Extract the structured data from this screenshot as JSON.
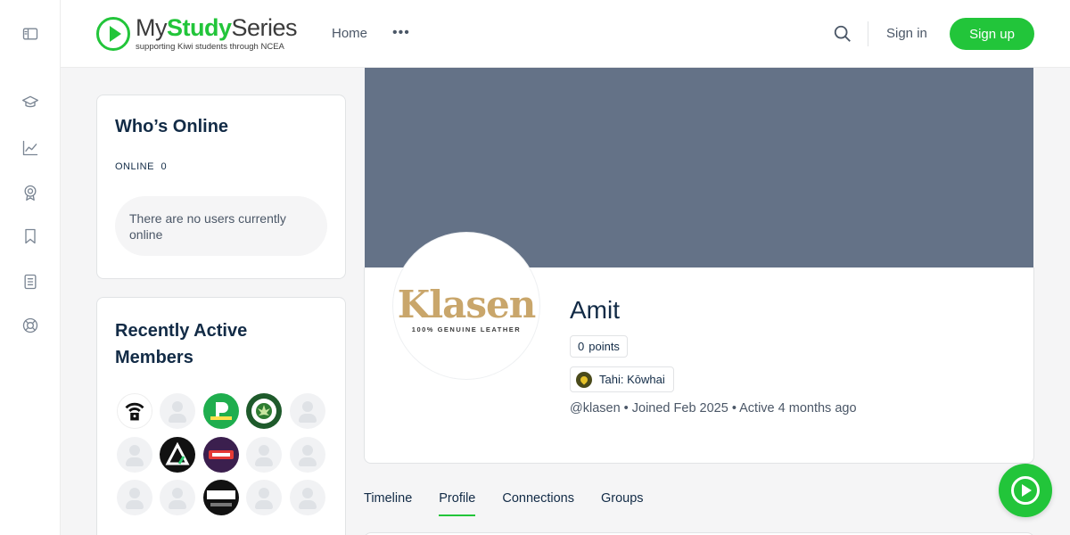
{
  "brand": {
    "name_prefix": "My",
    "name_highlight": "Study",
    "name_suffix": "Series",
    "tagline": "supporting Kiwi students through NCEA",
    "accent": "#22c53a"
  },
  "header": {
    "nav_home": "Home",
    "nav_more": "•••",
    "signin": "Sign in",
    "signup": "Sign up",
    "search_icon": "search-icon"
  },
  "rail": {
    "icons": [
      "sidebar-toggle-icon",
      "graduation-cap-icon",
      "chart-line-icon",
      "award-icon",
      "bookmark-icon",
      "document-list-icon",
      "help-lifebuoy-icon"
    ]
  },
  "whos_online": {
    "title": "Who’s Online",
    "online_label": "ONLINE",
    "online_count": "0",
    "empty_message": "There are no users currently online"
  },
  "recent_members": {
    "title": "Recently Active Members"
  },
  "profile": {
    "avatar_brand": "Klasen",
    "avatar_tagline": "100% GENUINE LEATHER",
    "name": "Amit",
    "points_value": "0",
    "points_label": "points",
    "rank": "Tahi: Kōwhai",
    "meta": "@klasen • Joined Feb 2025 • Active 4 months ago",
    "cover_color": "#647287"
  },
  "tabs": [
    {
      "label": "Timeline"
    },
    {
      "label": "Profile"
    },
    {
      "label": "Connections"
    },
    {
      "label": "Groups"
    }
  ],
  "active_tab": "Profile"
}
